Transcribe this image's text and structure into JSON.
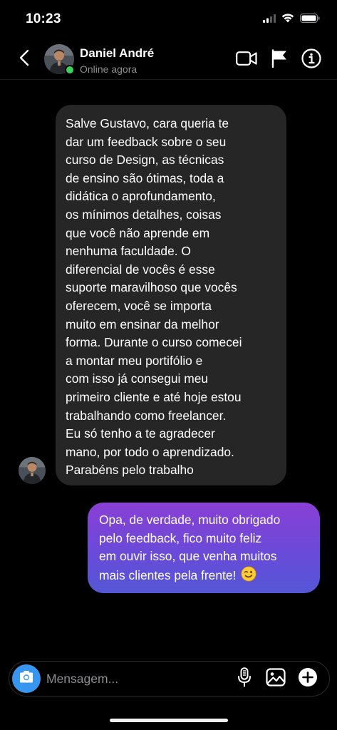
{
  "status_bar": {
    "time": "10:23",
    "icons": [
      "cellular-signal-icon",
      "wifi-icon",
      "battery-icon"
    ]
  },
  "header": {
    "contact_name": "Daniel André",
    "contact_status": "Online agora",
    "online_color": "#3ad45a",
    "icons": [
      "back-chevron-icon",
      "video-camera-icon",
      "flag-icon",
      "info-icon"
    ]
  },
  "messages": [
    {
      "direction": "incoming",
      "lines": [
        "Salve Gustavo, cara queria te",
        "dar um feedback sobre o seu",
        "curso de Design, as técnicas",
        "de ensino são ótimas, toda a",
        "didática o aprofundamento,",
        "os mínimos detalhes, coisas",
        "que você não aprende em",
        "nenhuma faculdade. O",
        "diferencial de vocês é esse",
        "suporte maravilhoso que vocês",
        "oferecem, você se importa",
        "muito em ensinar da melhor",
        "forma. Durante o curso comecei",
        "a montar meu portifólio e",
        "com isso já consegui meu",
        "primeiro cliente e até hoje estou",
        "trabalhando como freelancer.",
        "Eu só tenho a te agradecer",
        "mano, por todo o aprendizado.",
        "Parabéns pelo trabalho"
      ],
      "bubble_color": "#262626"
    },
    {
      "direction": "outgoing",
      "lines": [
        "Opa, de verdade, muito obrigado",
        "pelo feedback, fico muito feliz",
        "em ouvir isso, que venha muitos",
        "mais clientes pela frente!"
      ],
      "emoji": "winking-face-icon",
      "gradient": [
        "#8a3fd6",
        "#6a4ad8",
        "#5457d6"
      ]
    }
  ],
  "composer": {
    "placeholder": "Mensagem...",
    "camera_color": "#3797f0",
    "icons": [
      "camera-icon",
      "microphone-icon",
      "gallery-icon",
      "add-icon"
    ]
  }
}
